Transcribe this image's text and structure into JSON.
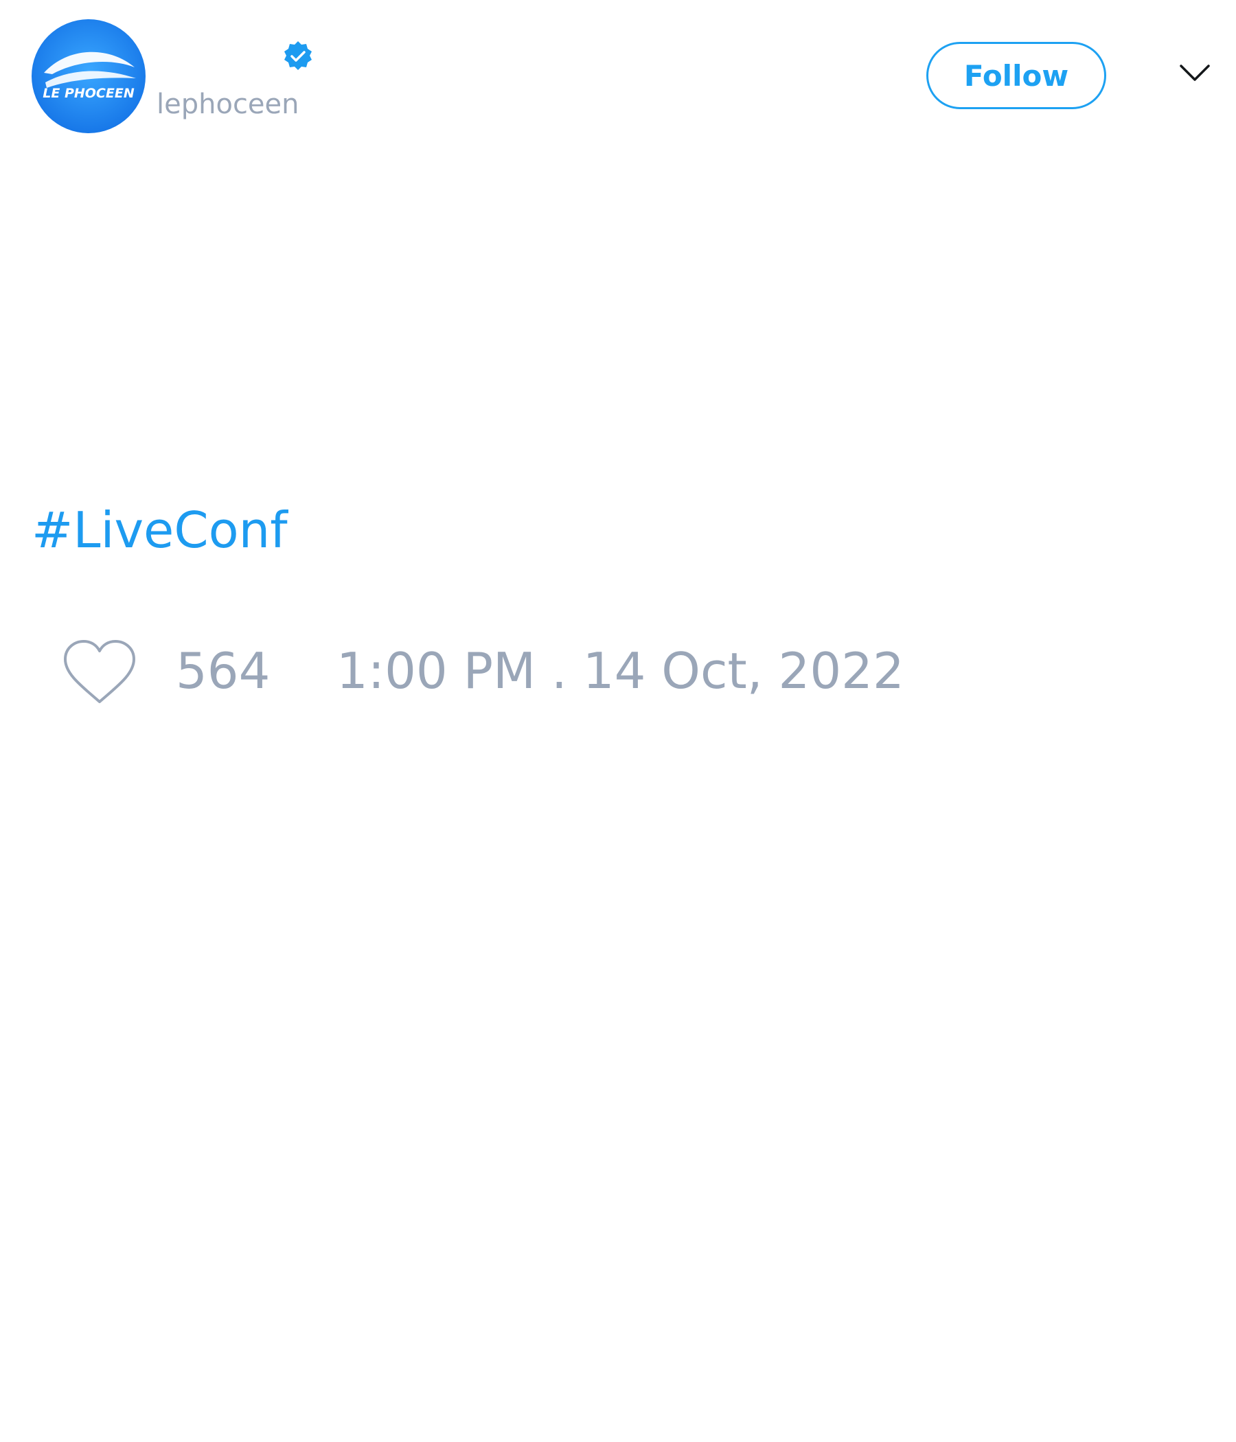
{
  "author": {
    "handle": "lephoceen",
    "avatar_logo_text": "LE PHOCEEN",
    "avatar_icon": "le-phoceen-logo",
    "verified": true,
    "verified_icon": "verified-badge-icon"
  },
  "header": {
    "follow_label": "Follow",
    "menu_icon": "chevron-down-icon"
  },
  "tweet": {
    "text": "#LiveConf"
  },
  "footer": {
    "like_icon": "heart-outline-icon",
    "like_count": "564",
    "timestamp": "1:00 PM . 14 Oct, 2022"
  },
  "colors": {
    "accent": "#1d9bf0",
    "muted_text": "#9aa6b8",
    "background": "#ffffff"
  }
}
